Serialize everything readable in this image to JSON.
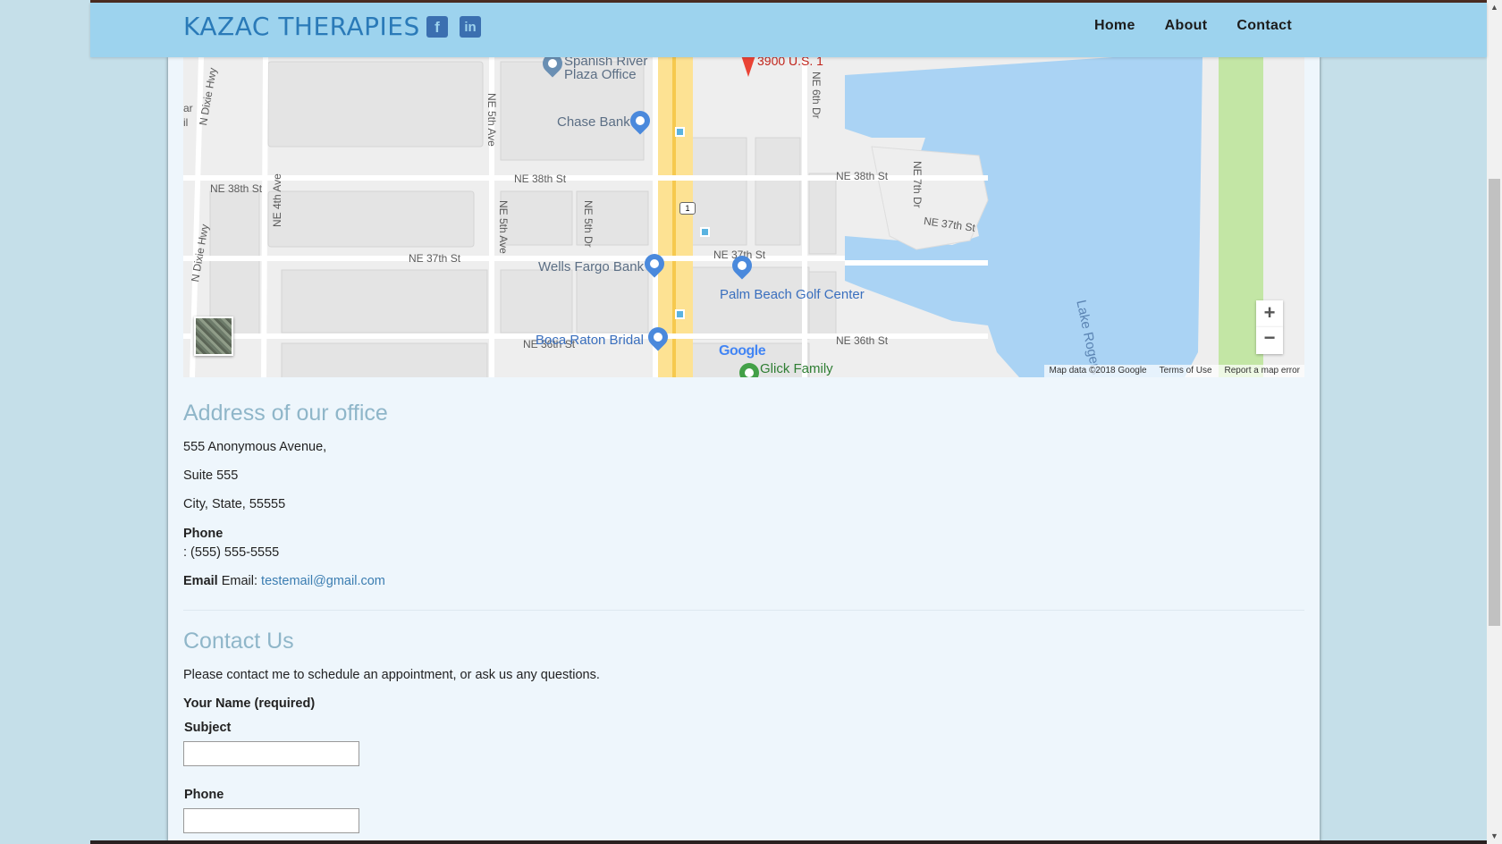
{
  "header": {
    "brand": "KAZAC THERAPIES",
    "social": [
      {
        "name": "facebook",
        "glyph": "f"
      },
      {
        "name": "linkedin",
        "glyph": "in"
      }
    ],
    "nav": [
      {
        "label": "Home"
      },
      {
        "label": "About"
      },
      {
        "label": "Contact"
      }
    ]
  },
  "map": {
    "streets": [
      "N Dixie Hwy",
      "NE 38th St",
      "NE 38th St",
      "NE 38th St",
      "NE 37th St",
      "NE 37th St",
      "NE 37th St",
      "NE 36th St",
      "NE 36th St",
      "NE 4th Ave",
      "NE 5th Ave",
      "NE 5th Ave",
      "NE 5th Dr",
      "NE 6th Dr",
      "NE 7th Dr",
      "N Dixie Hwy",
      "St",
      "ar",
      "il"
    ],
    "places": {
      "spanish_river": "Spanish River",
      "plaza_office": "Plaza Office",
      "chase": "Chase Bank",
      "wells_fargo": "Wells Fargo Bank",
      "palm_beach": "Palm Beach Golf Center",
      "boca_raton": "Boca Raton Bridal",
      "glick": "Glick Family",
      "marker": "3900 U.S. 1",
      "lake": "Lake Rogers",
      "route": "1"
    },
    "google": "Google",
    "attribution": {
      "data": "Map data ©2018 Google",
      "terms": "Terms of Use",
      "report": "Report a map error"
    },
    "zoom_in": "+",
    "zoom_out": "−"
  },
  "address": {
    "heading": "Address of our office",
    "line1": "555 Anonymous Avenue,",
    "line2": "Suite 555",
    "line3": "City, State, 55555",
    "phone_label": "Phone",
    "phone_value": ": (555) 555-5555",
    "email_label": "Email",
    "email_prefix": "Email:",
    "email_value": "testemail@gmail.com"
  },
  "contact": {
    "heading": "Contact Us",
    "intro": "Please contact me to schedule an appointment, or ask us any questions.",
    "name_label": "Your Name (required)",
    "subject_label": "Subject",
    "phone_label": "Phone",
    "subject_value": "",
    "phone_value": ""
  },
  "colors": {
    "navbar": "#9dd3ee",
    "brand": "#2a7ab8",
    "heading": "#8fb6c9",
    "link": "#3b7db1",
    "page_bg": "#c5dfe9",
    "card_bg": "#eef6fc"
  }
}
